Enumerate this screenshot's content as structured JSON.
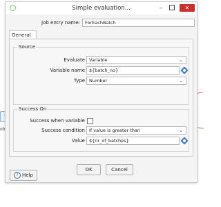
{
  "background": {
    "left_icon_glyph": "S",
    "left_label": "ob i"
  },
  "window": {
    "title": "Simple evaluation...",
    "minimize_glyph": "–",
    "close_glyph": "✕"
  },
  "job_entry": {
    "label": "Job entry name:",
    "value": "ForEachBatch"
  },
  "tabs": [
    {
      "label": "General"
    }
  ],
  "source": {
    "group_label": "Source",
    "evaluate_label": "Evaluate",
    "evaluate_value": "Variable",
    "variable_name_label": "Variable name",
    "variable_name_value": "${batch_no}",
    "type_label": "Type",
    "type_value": "Number"
  },
  "success_on": {
    "group_label": "Success On",
    "when_variable_label": "Success when variable",
    "when_variable_checked": false,
    "condition_label": "Success condition",
    "condition_value": "If value is greater than",
    "value_label": "Value",
    "value_value": "${nr_of_batches}"
  },
  "buttons": {
    "ok": "OK",
    "cancel": "Cancel",
    "help": "Help"
  },
  "colors": {
    "close_button": "#c9302c",
    "variable_icon": "#4b7fc4"
  },
  "icons": {
    "app": "evaluation-icon",
    "variable": "variable-diamond-icon",
    "help": "help-circle-icon",
    "dropdown": "chevron-down-icon"
  }
}
